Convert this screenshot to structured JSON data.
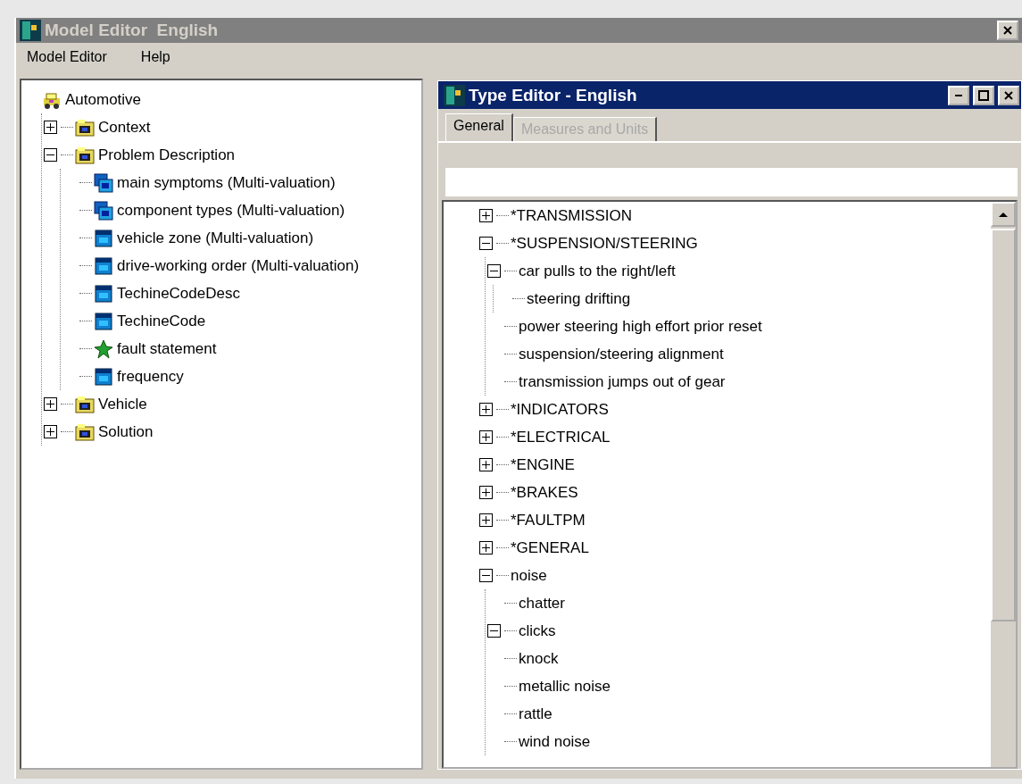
{
  "window": {
    "title": "Model Editor  English"
  },
  "menu": [
    {
      "label": "Model Editor"
    },
    {
      "label": "Help"
    }
  ],
  "model_tree": [
    {
      "label": "Automotive",
      "kind": "root",
      "children": [
        {
          "label": "Context",
          "kind": "category",
          "expanded": false
        },
        {
          "label": "Problem Description",
          "kind": "category",
          "expanded": true,
          "children": [
            {
              "label": "main symptoms (Multi-valuation)",
              "kind": "multi"
            },
            {
              "label": "component types (Multi-valuation)",
              "kind": "multi"
            },
            {
              "label": "vehicle zone (Multi-valuation)",
              "kind": "attribute"
            },
            {
              "label": "drive-working order (Multi-valuation)",
              "kind": "attribute"
            },
            {
              "label": "TechineCodeDesc",
              "kind": "attribute"
            },
            {
              "label": "TechineCode",
              "kind": "attribute"
            },
            {
              "label": "fault statement",
              "kind": "statement"
            },
            {
              "label": "frequency",
              "kind": "attribute"
            }
          ]
        },
        {
          "label": "Vehicle",
          "kind": "category",
          "expanded": false
        },
        {
          "label": "Solution",
          "kind": "category",
          "expanded": false
        }
      ]
    }
  ],
  "type_editor": {
    "title": "Type Editor - English",
    "tabs": [
      {
        "label": "General",
        "selected": true,
        "disabled": false
      },
      {
        "label": "Measures and Units",
        "selected": false,
        "disabled": true
      }
    ],
    "tree": [
      {
        "label": "*TRANSMISSION",
        "expanded": false
      },
      {
        "label": "*SUSPENSION/STEERING",
        "expanded": true,
        "children": [
          {
            "label": "car pulls to the right/left",
            "expanded": true,
            "children": [
              {
                "label": "steering drifting"
              }
            ]
          },
          {
            "label": "power steering high effort prior reset"
          },
          {
            "label": "suspension/steering alignment"
          },
          {
            "label": "transmission jumps out of gear"
          }
        ]
      },
      {
        "label": "*INDICATORS",
        "expanded": false
      },
      {
        "label": "*ELECTRICAL",
        "expanded": false
      },
      {
        "label": "*ENGINE",
        "expanded": false
      },
      {
        "label": "*BRAKES",
        "expanded": false
      },
      {
        "label": "*FAULTPM",
        "expanded": false
      },
      {
        "label": "*GENERAL",
        "expanded": false
      },
      {
        "label": "noise",
        "expanded": true,
        "children": [
          {
            "label": "chatter"
          },
          {
            "label": "clicks",
            "expanded": true
          },
          {
            "label": "knock"
          },
          {
            "label": "metallic noise"
          },
          {
            "label": "rattle"
          },
          {
            "label": "wind noise"
          }
        ]
      }
    ]
  }
}
